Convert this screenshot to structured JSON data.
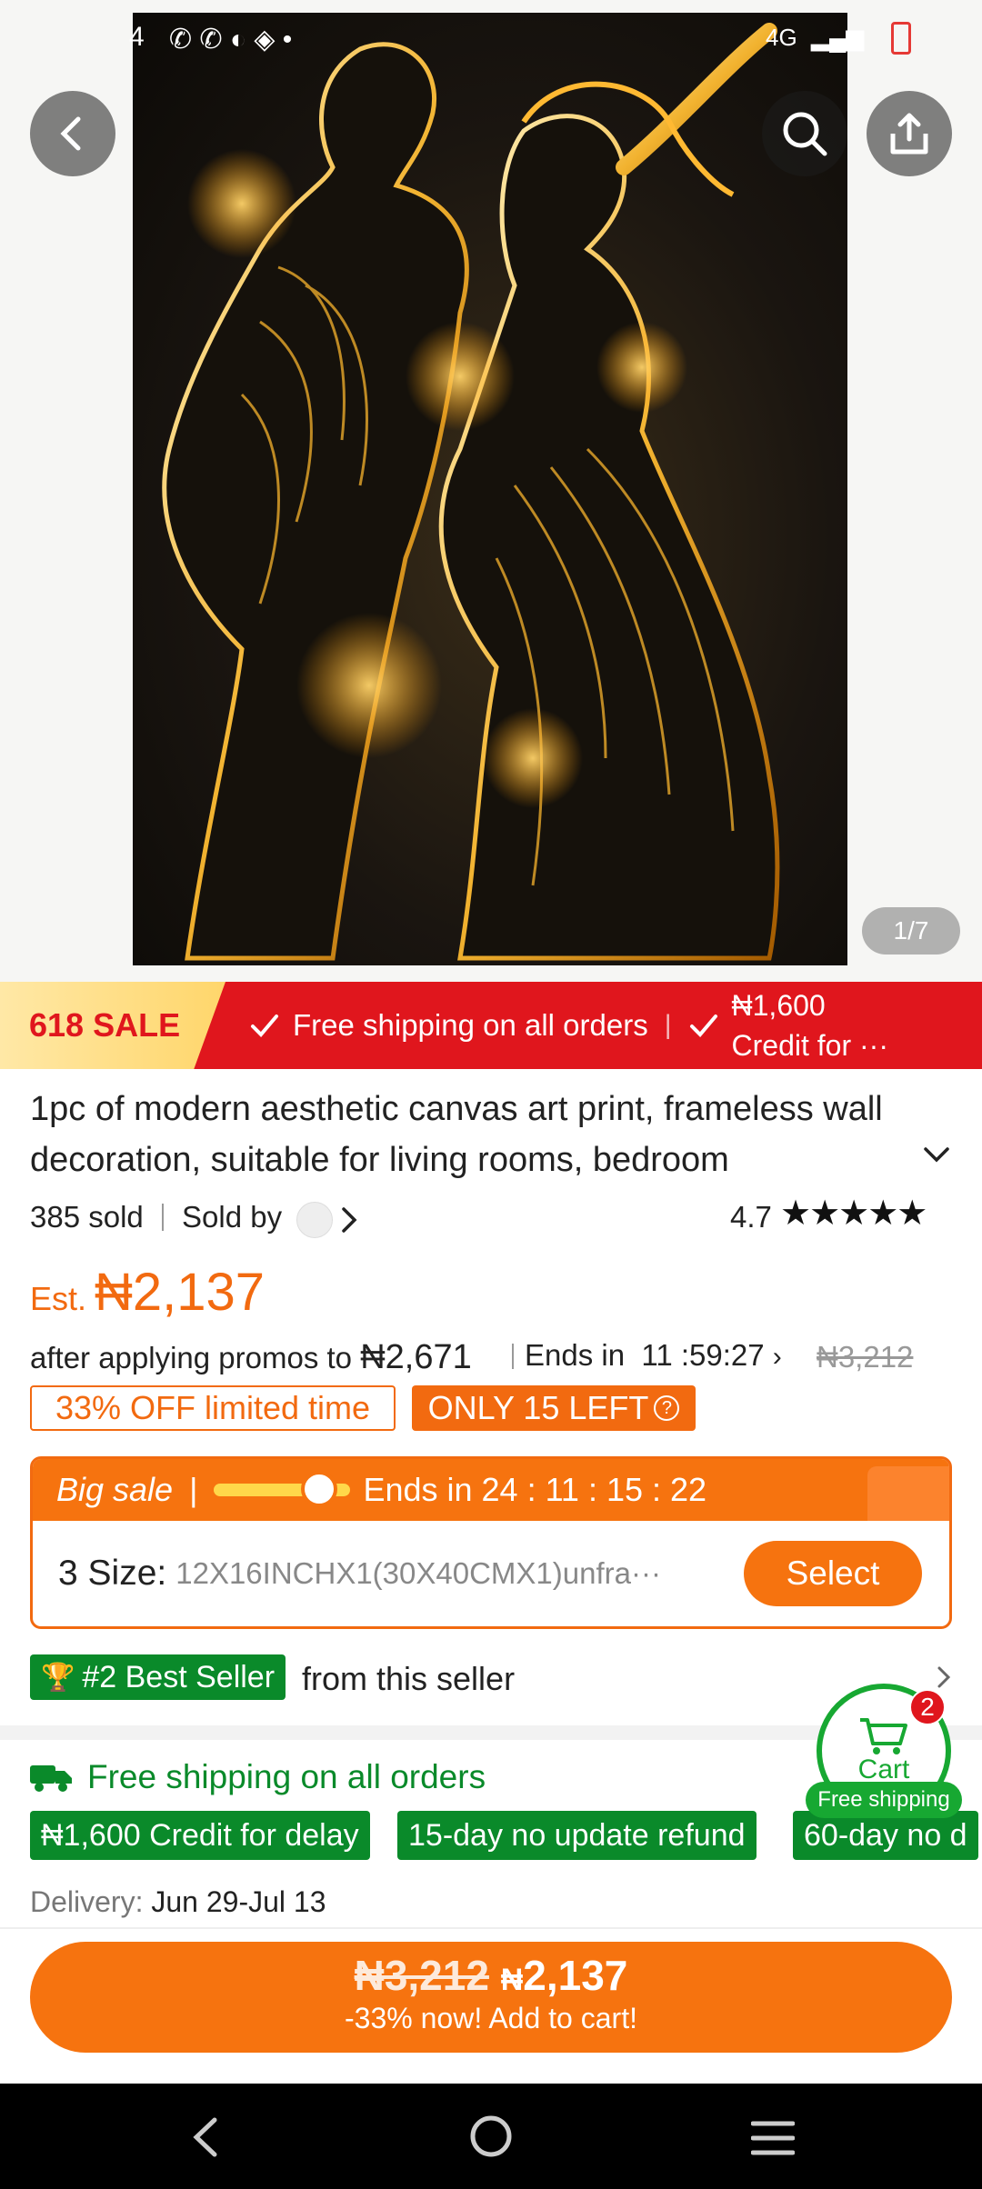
{
  "status_bar": {
    "time_partial": "4",
    "network": "4G"
  },
  "hero": {
    "image_counter": "1/7",
    "image_alt": "Golden dancing couple canvas art"
  },
  "sale_banner": {
    "tag": "618 SALE",
    "item1": "Free shipping on all orders",
    "item2_line1": "₦1,600",
    "item2_line2": "Credit for ···"
  },
  "product": {
    "title": "1pc of modern aesthetic canvas art print, frameless wall decoration, suitable for living rooms, bedroom",
    "sold": "385 sold",
    "sold_by": "Sold by",
    "rating": "4.7",
    "stars": 4.7
  },
  "price": {
    "est_label": "Est.",
    "est_value": "₦2,137",
    "promo_text": "after applying promos to",
    "promo_value": "₦2,671",
    "ends_label": "Ends in",
    "ends_time": "11 :59:27",
    "original": "₦3,212",
    "off_tag": "33% OFF limited time",
    "left_tag": "ONLY 15 LEFT"
  },
  "big_sale": {
    "label": "Big sale",
    "ends_label": "Ends in",
    "ends_time": "24 : 11 : 15 : 22",
    "size_label": "3 Size:",
    "size_value": "12X16INCHX1(30X40CMX1)unfra···",
    "select_label": "Select"
  },
  "best_seller": {
    "badge": "#2 Best Seller",
    "text": "from this seller"
  },
  "shipping": {
    "title": "Free shipping on all orders",
    "tags": [
      "₦1,600 Credit for delay",
      "15-day no update refund",
      "60-day no d"
    ],
    "delivery_label": "Delivery:",
    "delivery_value": "Jun 29-Jul 13"
  },
  "cart": {
    "count": "2",
    "label": "Cart",
    "badge": "Free shipping"
  },
  "add_to_cart": {
    "old_price": "₦3,212",
    "new_price_symbol": "₦",
    "new_price": "2,137",
    "subtitle": "-33% now! Add to cart!"
  },
  "colors": {
    "accent": "#f26a10",
    "sale_red": "#e0161d",
    "green": "#0a8a2a"
  }
}
